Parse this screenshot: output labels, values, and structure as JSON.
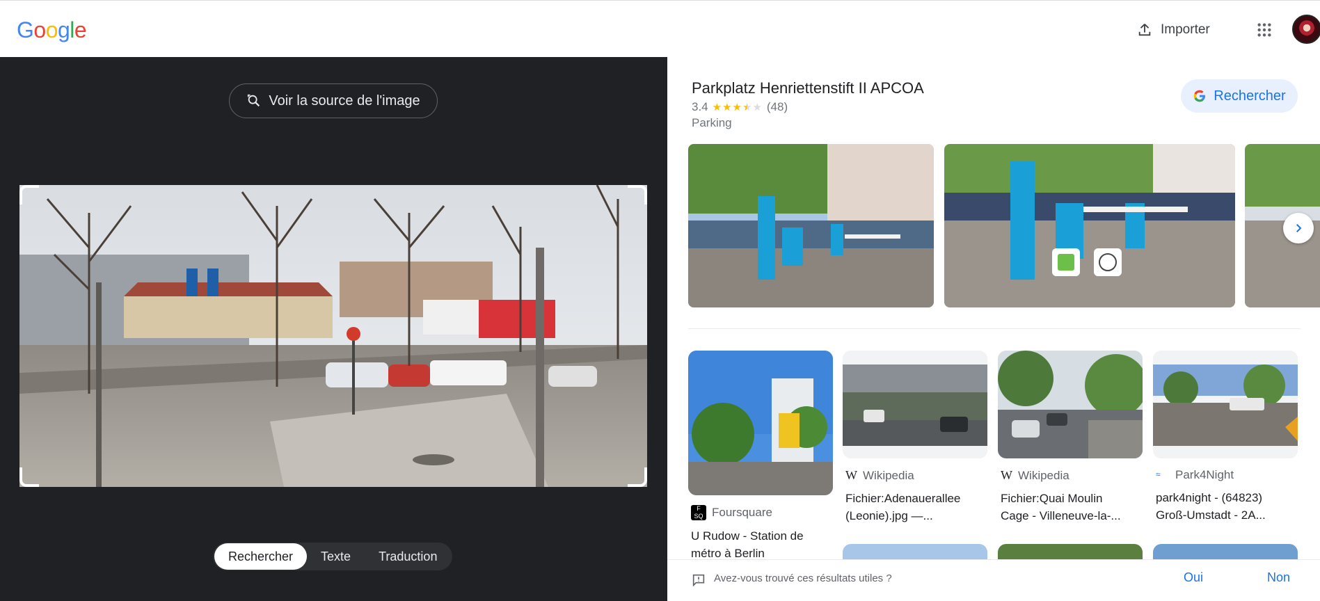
{
  "header": {
    "logo_letters": [
      "G",
      "o",
      "o",
      "g",
      "l",
      "e"
    ],
    "logo_colors": [
      "#4285F4",
      "#EA4335",
      "#FBBC05",
      "#4285F4",
      "#34A853",
      "#EA4335"
    ],
    "import_label": "Importer"
  },
  "viewer": {
    "source_button_label": "Voir la source de l'image",
    "modes": [
      "Rechercher",
      "Texte",
      "Traduction"
    ],
    "active_mode": "Rechercher"
  },
  "place": {
    "title": "Parkplatz Henriettenstift II APCOA",
    "rating": "3.4",
    "rating_value": 3.4,
    "review_count": "(48)",
    "type": "Parking",
    "search_button_label": "Rechercher"
  },
  "results": [
    {
      "source": "Foursquare",
      "title_line1": "U Rudow - Station de",
      "title_line2": "métro à Berlin"
    },
    {
      "source": "Wikipedia",
      "title_line1": "Fichier:Adenauerallee",
      "title_line2": "(Leonie).jpg —..."
    },
    {
      "source": "Wikipedia",
      "title_line1": "Fichier:Quai Moulin",
      "title_line2": "Cage - Villeneuve-la-..."
    },
    {
      "source": "Park4Night",
      "title_line1": "park4night - (64823)",
      "title_line2": "Groß-Umstadt - 2A..."
    }
  ],
  "feedback": {
    "question": "Avez-vous trouvé ces résultats utiles ?",
    "yes": "Oui",
    "no": "Non"
  },
  "icons": {
    "upload": "upload-icon",
    "apps": "apps-grid-icon",
    "lens": "lens-search-icon",
    "chevron": "chevron-right-icon",
    "feedback": "feedback-icon",
    "wikipedia": "wikipedia-icon",
    "foursquare": "foursquare-icon",
    "park4night": "park4night-icon"
  }
}
